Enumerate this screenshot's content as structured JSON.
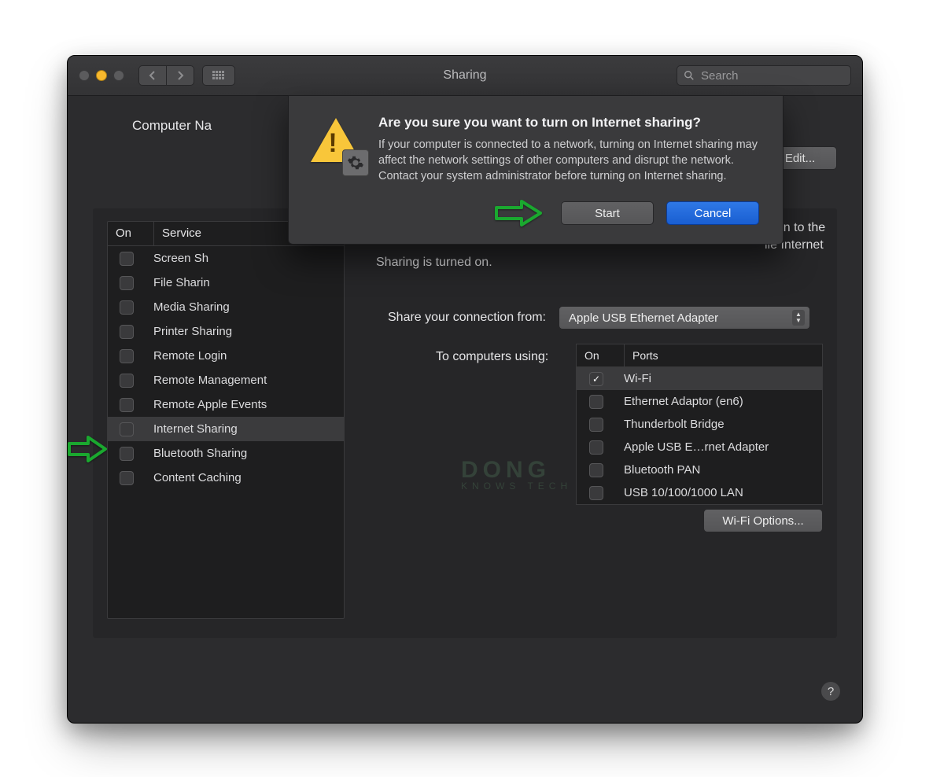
{
  "window": {
    "title": "Sharing"
  },
  "toolbar": {
    "search_placeholder": "Search"
  },
  "top": {
    "computer_name_label": "Computer Na",
    "edit_label": "Edit..."
  },
  "services": {
    "header_on": "On",
    "header_service": "Service",
    "items": [
      {
        "label": "Screen Sh",
        "checked": false
      },
      {
        "label": "File Sharin",
        "checked": false
      },
      {
        "label": "Media Sharing",
        "checked": false
      },
      {
        "label": "Printer Sharing",
        "checked": false
      },
      {
        "label": "Remote Login",
        "checked": false
      },
      {
        "label": "Remote Management",
        "checked": false
      },
      {
        "label": "Remote Apple Events",
        "checked": false
      },
      {
        "label": "Internet Sharing",
        "checked": false,
        "selected": true
      },
      {
        "label": "Bluetooth Sharing",
        "checked": false
      },
      {
        "label": "Content Caching",
        "checked": false
      }
    ]
  },
  "detail": {
    "status_line1": "ection to the",
    "status_line2": "ile Internet",
    "status_line3": "Sharing is turned on.",
    "share_from_label": "Share your connection from:",
    "share_from_value": "Apple USB Ethernet Adapter",
    "to_label": "To computers using:",
    "ports_header_on": "On",
    "ports_header_ports": "Ports",
    "ports": [
      {
        "label": "Wi-Fi",
        "checked": true,
        "selected": true
      },
      {
        "label": "Ethernet Adaptor (en6)",
        "checked": false
      },
      {
        "label": "Thunderbolt Bridge",
        "checked": false
      },
      {
        "label": "Apple USB E…rnet Adapter",
        "checked": false
      },
      {
        "label": "Bluetooth PAN",
        "checked": false
      },
      {
        "label": "USB 10/100/1000 LAN",
        "checked": false
      }
    ],
    "wifi_options_label": "Wi-Fi Options..."
  },
  "dialog": {
    "title": "Are you sure you want to turn on Internet sharing?",
    "body": "If your computer is connected to a network, turning on Internet sharing may affect the network settings of other computers and disrupt the network. Contact your system administrator before turning on Internet sharing.",
    "start_label": "Start",
    "cancel_label": "Cancel"
  },
  "help_glyph": "?",
  "watermark": {
    "line1": "DONG",
    "line2": "KNOWS TECH"
  }
}
